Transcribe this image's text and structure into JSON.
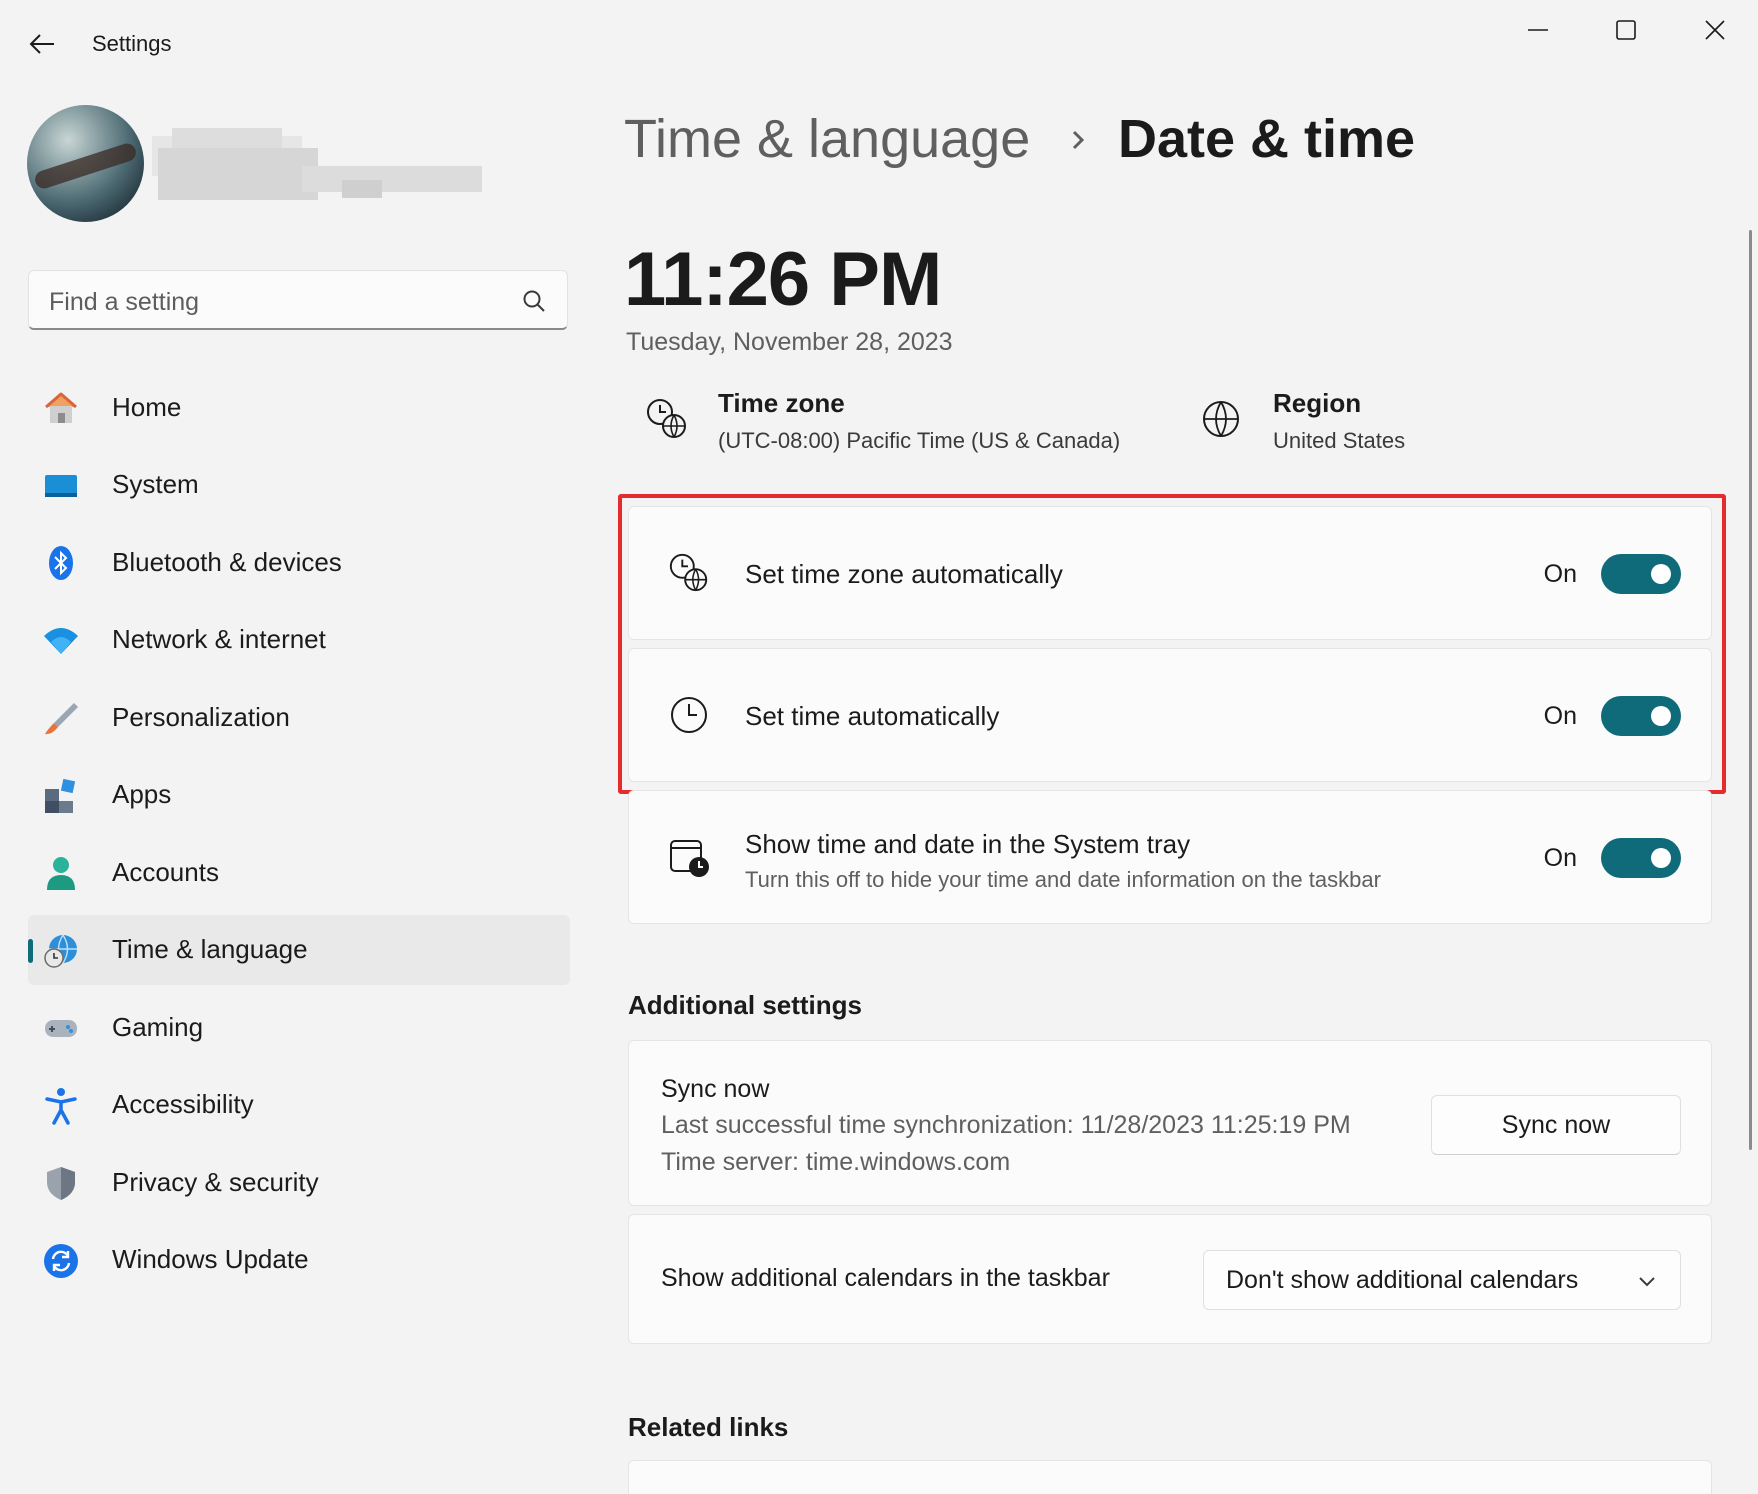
{
  "window": {
    "title": "Settings",
    "back_icon": "back-arrow-icon",
    "minimize_icon": "minimize-icon",
    "maximize_icon": "maximize-icon",
    "close_icon": "close-icon"
  },
  "search": {
    "placeholder": "Find a setting",
    "icon": "search-icon"
  },
  "sidebar": {
    "items": [
      {
        "label": "Home",
        "icon": "home-icon",
        "active": false
      },
      {
        "label": "System",
        "icon": "monitor-icon",
        "active": false
      },
      {
        "label": "Bluetooth & devices",
        "icon": "bluetooth-icon",
        "active": false
      },
      {
        "label": "Network & internet",
        "icon": "wifi-icon",
        "active": false
      },
      {
        "label": "Personalization",
        "icon": "brush-icon",
        "active": false
      },
      {
        "label": "Apps",
        "icon": "apps-icon",
        "active": false
      },
      {
        "label": "Accounts",
        "icon": "person-icon",
        "active": false
      },
      {
        "label": "Time & language",
        "icon": "globe-clock-icon",
        "active": true
      },
      {
        "label": "Gaming",
        "icon": "gamepad-icon",
        "active": false
      },
      {
        "label": "Accessibility",
        "icon": "accessibility-icon",
        "active": false
      },
      {
        "label": "Privacy & security",
        "icon": "shield-icon",
        "active": false
      },
      {
        "label": "Windows Update",
        "icon": "refresh-icon",
        "active": false
      }
    ]
  },
  "header": {
    "breadcrumb_parent": "Time & language",
    "breadcrumb_separator_icon": "chevron-right-icon",
    "title": "Date & time"
  },
  "clock": {
    "time": "11:26 PM",
    "date": "Tuesday, November 28, 2023"
  },
  "info": {
    "time_zone_label": "Time zone",
    "time_zone_value": "(UTC-08:00) Pacific Time (US & Canada)",
    "region_label": "Region",
    "region_value": "United States"
  },
  "settings": {
    "set_tz_auto": {
      "label": "Set time zone automatically",
      "state": "On",
      "on": true
    },
    "set_time_auto": {
      "label": "Set time automatically",
      "state": "On",
      "on": true
    },
    "show_tray": {
      "label": "Show time and date in the System tray",
      "description": "Turn this off to hide your time and date information on the taskbar",
      "state": "On",
      "on": true
    }
  },
  "additional": {
    "section_title": "Additional settings",
    "sync_title": "Sync now",
    "sync_last": "Last successful time synchronization: 11/28/2023 11:25:19 PM",
    "sync_server": "Time server: time.windows.com",
    "sync_button": "Sync now",
    "calendars_label": "Show additional calendars in the taskbar",
    "calendars_value": "Don't show additional calendars"
  },
  "related": {
    "section_title": "Related links"
  },
  "colors": {
    "accent": "#0f6b7a",
    "highlight": "#e52b2b"
  }
}
